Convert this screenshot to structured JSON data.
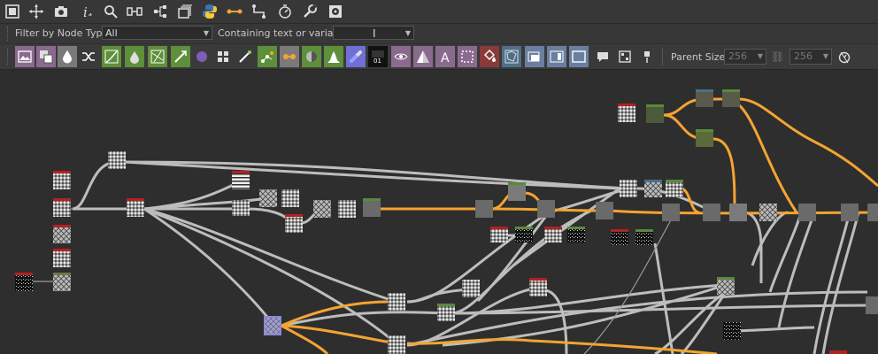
{
  "toolbar_top": {
    "icons": [
      "frame-all-icon",
      "center-view-icon",
      "snapshot-icon",
      "info-icon",
      "search-icon",
      "link-icon",
      "hierarchy-icon",
      "layers-icon",
      "python-icon",
      "connection-orange-icon",
      "route-icon",
      "timer-icon",
      "wrench-icon",
      "display-icon"
    ]
  },
  "filter": {
    "node_type_label": "Filter by Node Type",
    "node_type_value": "All",
    "text_label": "Containing text or variable",
    "text_value": ""
  },
  "nodebar": {
    "icons": [
      "image-input-icon",
      "uniform-color-icon",
      "gradient-icon",
      "shuffle-icon",
      "curve-icon",
      "levels-icon",
      "warp-icon",
      "transform-icon",
      "blend-circle-icon",
      "tile-grid-icon",
      "fx-map-icon",
      "pixel-processor-icon",
      "value-processor-icon",
      "sphere-icon",
      "histogram-icon",
      "hsl-icon",
      "bitmap-01-icon",
      "blur-icon",
      "sharpen-icon",
      "text-icon",
      "crop-icon",
      "fill-icon",
      "distance-icon",
      "normal-icon",
      "ambient-icon",
      "output-icon",
      "comment-icon",
      "frame-icon",
      "pin-icon"
    ],
    "parent_size_label": "Parent Size:",
    "parent_size_w": "256",
    "parent_size_h": "256"
  },
  "colors": {
    "accent_orange": "#f4a431",
    "wire_gray": "#bdbdbd",
    "graph_bg": "#2e2e2e"
  }
}
